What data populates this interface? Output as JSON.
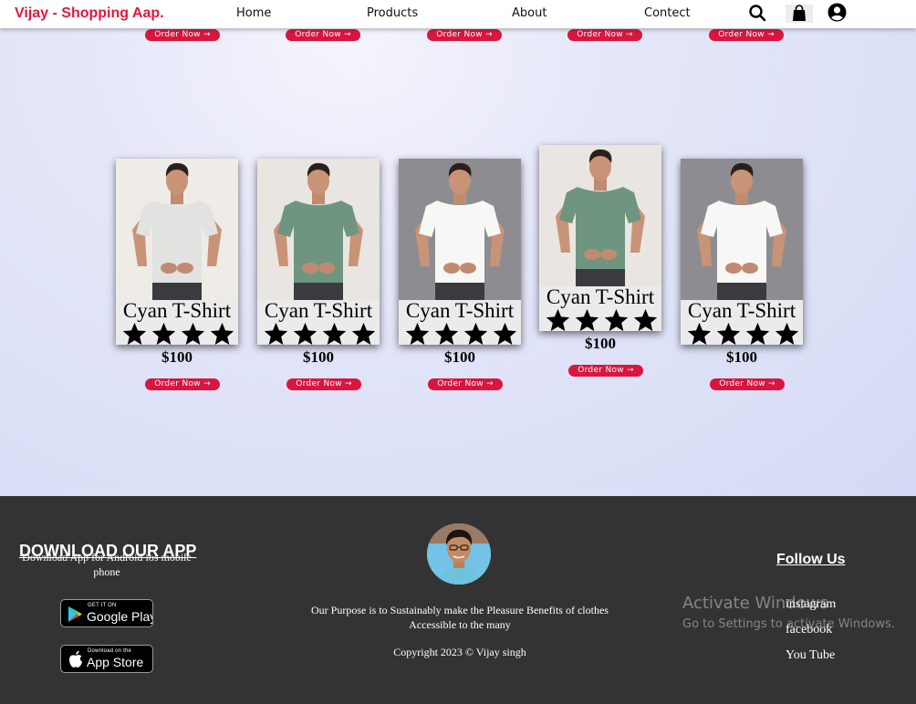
{
  "navbar": {
    "brand": "Vijay - Shopping Aap.",
    "links": [
      "Home",
      "Products",
      "About",
      "Contect"
    ],
    "icons": [
      "search-icon",
      "shopping-bag-icon",
      "user-circle-icon"
    ]
  },
  "order_label": "Order Now",
  "top_row": {
    "order_buttons": [
      "Order Now",
      "Order Now",
      "Order Now",
      "Order Now",
      "Order Now"
    ]
  },
  "products": [
    {
      "name": "Cyan T-Shirt",
      "rating": 4,
      "price": "$100",
      "order_label": "Order Now",
      "shirt_color": "#e2e3e1",
      "backdrop": "#efece8"
    },
    {
      "name": "Cyan T-Shirt",
      "rating": 4,
      "price": "$100",
      "order_label": "Order Now",
      "shirt_color": "#6f9580",
      "backdrop": "#e9e6e1"
    },
    {
      "name": "Cyan T-Shirt",
      "rating": 4,
      "price": "$100",
      "order_label": "Order Now",
      "shirt_color": "#f7f7f5",
      "backdrop": "#8d8d91"
    },
    {
      "name": "Cyan T-Shirt",
      "rating": 4,
      "price": "$100",
      "order_label": "Order Now",
      "shirt_color": "#6f9580",
      "backdrop": "#e9e6e1"
    },
    {
      "name": "Cyan T-Shirt",
      "rating": 4,
      "price": "$100",
      "order_label": "Order Now",
      "shirt_color": "#f7f7f5",
      "backdrop": "#8d8d91"
    }
  ],
  "footer": {
    "download_title": "DOWNLOAD OUR APP",
    "download_sub": "Download App for Android ios mobile phone",
    "google_play": {
      "small": "GET IT ON",
      "big": "Google Play"
    },
    "app_store": {
      "small": "Download on the",
      "big": "App Store"
    },
    "purpose": "Our Purpose is to Sustainably make the Pleasure Benefits of clothes Accessible to the many",
    "copyright": "Copyright 2023 © Vijay singh",
    "follow_title": "Follow Us",
    "social_links": [
      "instagram",
      "facebook",
      "You Tube"
    ],
    "watermark_title": "Activate Windows",
    "watermark_sub": "Go to Settings to activate Windows."
  },
  "colors": {
    "brand": "#e0173f",
    "order_button": "#d8163f",
    "footer_bg": "#333333"
  }
}
